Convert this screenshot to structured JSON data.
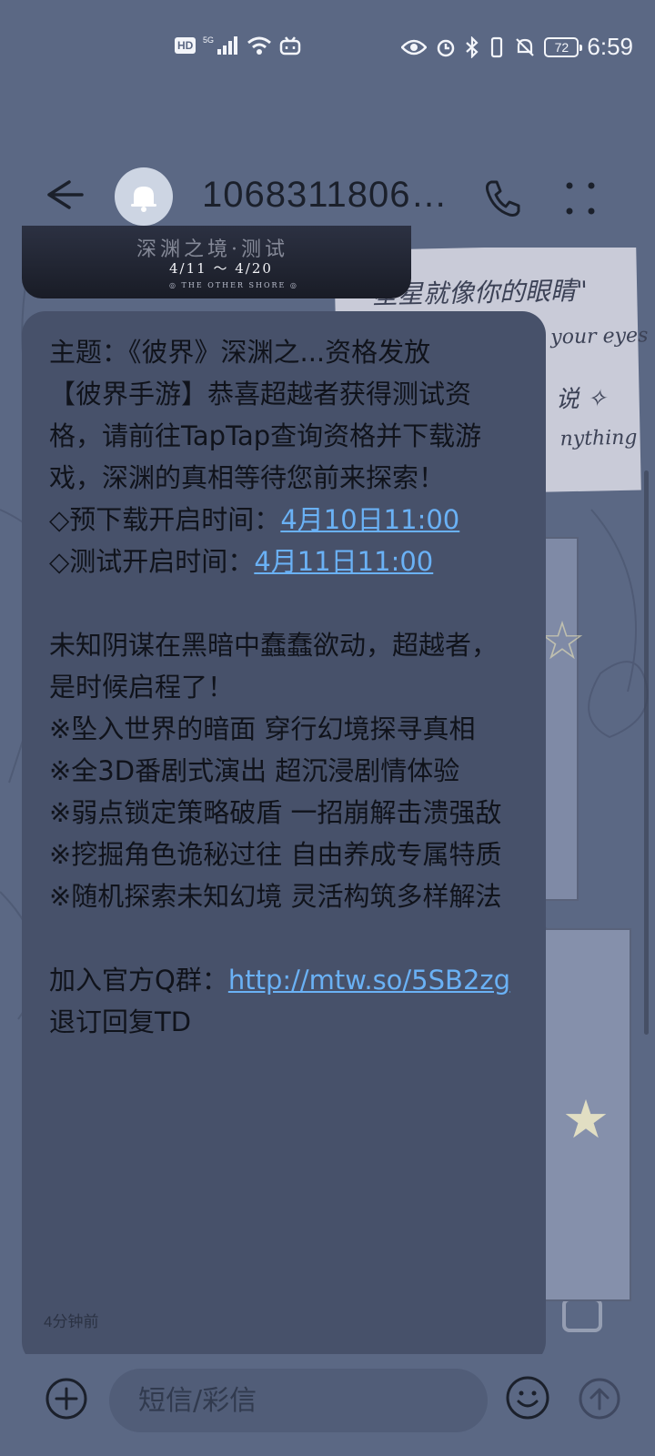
{
  "status_bar": {
    "hd_badge": "HD",
    "time": "6:59",
    "battery": "72",
    "icons": [
      "signal-5g-icon",
      "wifi-icon",
      "bilibili-icon",
      "eye-icon",
      "alarm-icon",
      "bluetooth-icon",
      "vibrate-icon",
      "mute-icon"
    ]
  },
  "header": {
    "contact_name": "1068311806…",
    "icons": [
      "back-arrow-icon",
      "bell-icon",
      "phone-icon",
      "more-icon"
    ]
  },
  "image_message": {
    "title": "深渊之境·测试",
    "dates": "4/11 ～ 4/20",
    "subtitle": "◎ THE OTHER SHORE ◎"
  },
  "wallpaper_note": {
    "line1": "\"星星就像你的眼睛\"",
    "line2": "your eyes",
    "line3": "说 ✧",
    "line4": "nything"
  },
  "message": {
    "subject": "主题：《彼界》深渊之...资格发放",
    "intro": "【彼界手游】恭喜超越者获得测试资格，请前往TapTap查询资格并下载游戏，深渊的真相等待您前来探索！",
    "predownload_label": "◇预下载开启时间：",
    "predownload_time": "4月10日11:00",
    "test_label": "◇测试开启时间：",
    "test_time": "4月11日11:00",
    "story": "未知阴谋在黑暗中蠢蠢欲动，超越者，是时候启程了！",
    "features": [
      "※坠入世界的暗面 穿行幻境探寻真相",
      "※全3D番剧式演出 超沉浸剧情体验",
      "※弱点锁定策略破盾 一招崩解击溃强敌",
      "※挖掘角色诡秘过往 自由养成专属特质",
      "※随机探索未知幻境 灵活构筑多样解法"
    ],
    "group_label": "加入官方Q群：",
    "group_link": "http://mtw.so/5SB2zg",
    "unsubscribe": "退订回复TD",
    "time": "4分钟前"
  },
  "input": {
    "placeholder": "短信/彩信",
    "icons": [
      "add-icon",
      "emoji-icon",
      "send-icon"
    ]
  },
  "colors": {
    "background": "#5b6884",
    "bubble": "#47516a",
    "link": "#6ab1f5"
  }
}
